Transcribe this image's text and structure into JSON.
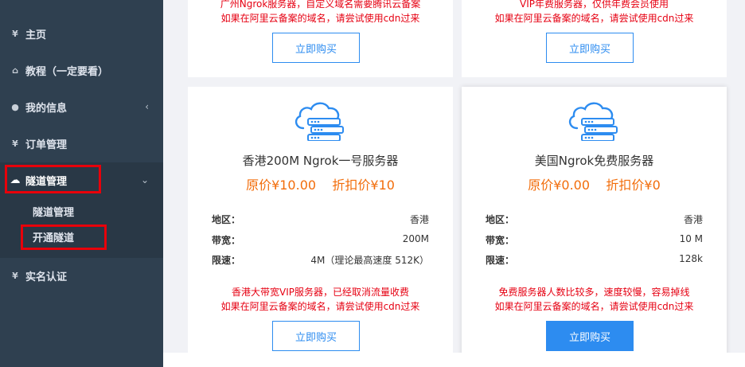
{
  "sidebar": {
    "items": [
      {
        "icon": "yen-icon",
        "glyph": "¥",
        "label": "主页"
      },
      {
        "icon": "home-icon",
        "glyph": "⌂",
        "label": "教程（一定要看）"
      },
      {
        "icon": "user-icon",
        "glyph": "●",
        "label": "我的信息",
        "arrow": "‹"
      },
      {
        "icon": "yen-icon",
        "glyph": "¥",
        "label": "订单管理"
      },
      {
        "icon": "cloud-icon",
        "glyph": "☁",
        "label": "隧道管理",
        "arrow": "⌄"
      },
      {
        "icon": "yen-icon",
        "glyph": "¥",
        "label": "实名认证"
      }
    ],
    "submenu": [
      "隧道管理",
      "开通隧道"
    ]
  },
  "cards_top": [
    {
      "note1": "广州Ngrok服务器，自定义域名需要腾讯云备案",
      "note2": "如果在阿里云备案的域名，请尝试使用cdn过来",
      "button": "立即购买"
    },
    {
      "note1": "VIP年费服务器，仅供年费会员使用",
      "note2": "如果在阿里云备案的域名，请尝试使用cdn过来",
      "button": "立即购买"
    }
  ],
  "cards": [
    {
      "title": "香港200M Ngrok一号服务器",
      "price": "原价¥10.00    折扣价¥10",
      "rows": [
        {
          "k": "地区：",
          "v": "香港"
        },
        {
          "k": "带宽：",
          "v": "200M"
        },
        {
          "k": "限速：",
          "v": "4M（理论最高速度 512K）"
        }
      ],
      "note1": "香港大带宽VIP服务器，已经取消流量收费",
      "note2": "如果在阿里云备案的域名，请尝试使用cdn过来",
      "button": "立即购买"
    },
    {
      "title": "美国Ngrok免费服务器",
      "price": "原价¥0.00    折扣价¥0",
      "rows": [
        {
          "k": "地区：",
          "v": "香港"
        },
        {
          "k": "带宽：",
          "v": "10 M"
        },
        {
          "k": "限速：",
          "v": "128k"
        }
      ],
      "note1": "免费服务器人数比较多，速度较慢，容易掉线",
      "note2": "如果在阿里云备案的域名，请尝试使用cdn过来",
      "button": "立即购买"
    }
  ],
  "colors": {
    "sidebar": "#2f4050",
    "accent": "#2d8cf0",
    "price": "#f26d0b",
    "note": "#e60012",
    "highlight": "#e8000a"
  }
}
